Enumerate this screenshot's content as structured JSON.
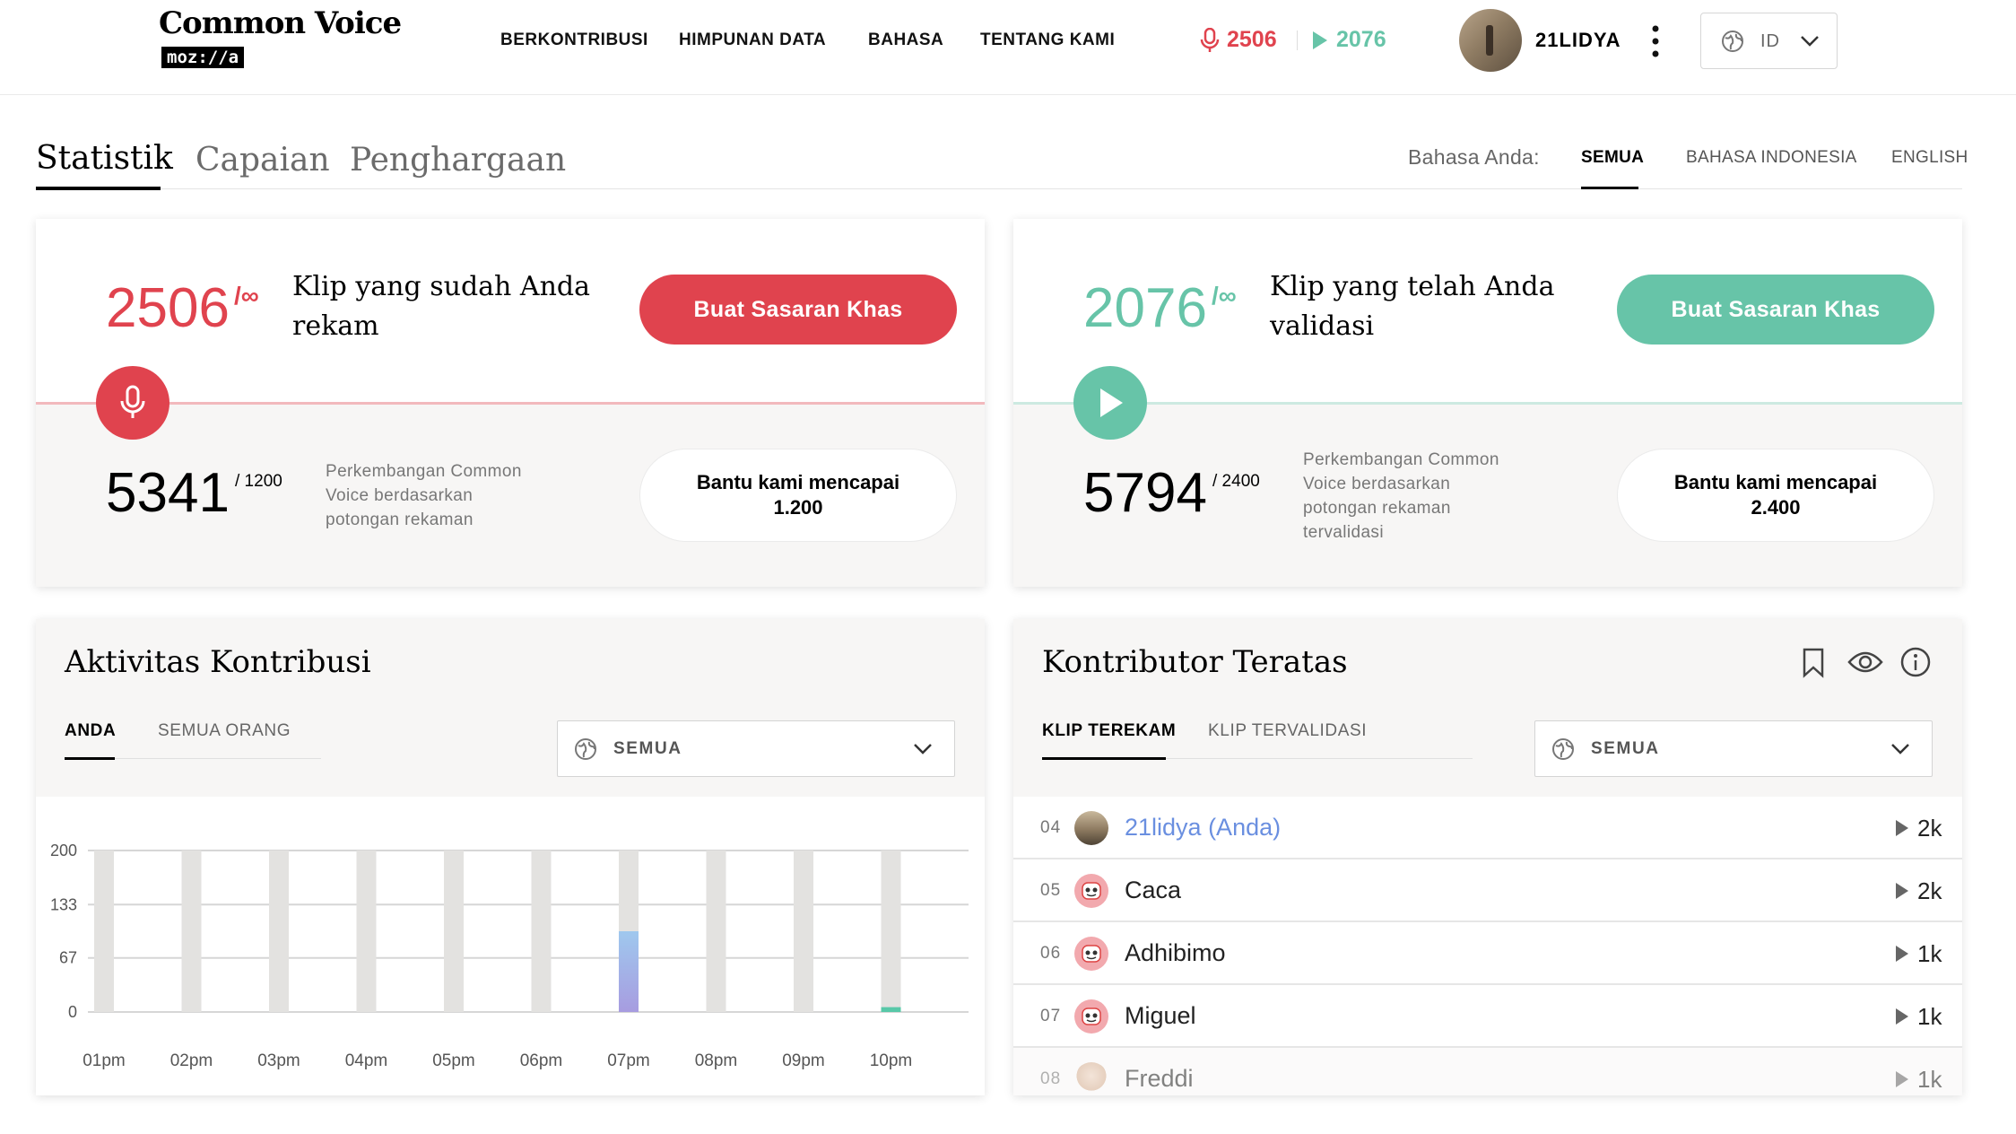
{
  "header": {
    "logo_title": "Common Voice",
    "logo_sub": "moz://a",
    "nav": [
      "BERKONTRIBUSI",
      "HIMPUNAN DATA",
      "BAHASA",
      "TENTANG KAMI"
    ],
    "recorded_count": "2506",
    "validated_count": "2076",
    "username": "21LIDYA",
    "language": "ID"
  },
  "tabs": {
    "items": [
      "Statistik",
      "Capaian",
      "Penghargaan"
    ],
    "active": "Statistik",
    "language_label": "Bahasa Anda:",
    "languages": [
      "SEMUA",
      "BAHASA INDONESIA",
      "ENGLISH"
    ],
    "active_language": "SEMUA"
  },
  "record_card": {
    "count": "2506",
    "goal_symbol": "/∞",
    "label_line1": "Klip yang sudah Anda",
    "label_line2": "rekam",
    "button": "Buat Sasaran Khas",
    "progress": "5341",
    "progress_goal": "/ 1200",
    "progress_desc": [
      "Perkembangan Common",
      "Voice berdasarkan",
      "potongan rekaman"
    ],
    "help_line1": "Bantu kami mencapai",
    "help_line2": "1.200"
  },
  "validate_card": {
    "count": "2076",
    "goal_symbol": "/∞",
    "label_line1": "Klip yang telah Anda",
    "label_line2": "validasi",
    "button": "Buat Sasaran Khas",
    "progress": "5794",
    "progress_goal": "/ 2400",
    "progress_desc": [
      "Perkembangan Common",
      "Voice berdasarkan",
      "potongan rekaman",
      "tervalidasi"
    ],
    "help_line1": "Bantu kami mencapai",
    "help_line2": "2.400"
  },
  "activity": {
    "title": "Aktivitas Kontribusi",
    "tabs": [
      "ANDA",
      "SEMUA ORANG"
    ],
    "active_tab": "ANDA",
    "dropdown": "SEMUA"
  },
  "chart_data": {
    "type": "bar",
    "categories": [
      "01pm",
      "02pm",
      "03pm",
      "04pm",
      "05pm",
      "06pm",
      "07pm",
      "08pm",
      "09pm",
      "10pm"
    ],
    "series": [
      {
        "values": [
          0,
          0,
          0,
          0,
          0,
          0,
          100,
          0,
          0,
          6
        ]
      }
    ],
    "yticks": [
      "200",
      "133",
      "67",
      "0"
    ],
    "ylim": [
      0,
      200
    ],
    "background_bars": true,
    "colors": {
      "bar": "#9fb7ea",
      "bar_end": "#58c8a8",
      "track": "#e3e2e0"
    }
  },
  "leaderboard": {
    "title": "Kontributor Teratas",
    "tabs": [
      "KLIP TEREKAM",
      "KLIP TERVALIDASI"
    ],
    "active_tab": "KLIP TEREKAM",
    "dropdown": "SEMUA",
    "rows": [
      {
        "rank": "04",
        "name": "21lidya (Anda)",
        "count": "2k",
        "self": true,
        "avatar": "photo"
      },
      {
        "rank": "05",
        "name": "Caca",
        "count": "2k",
        "avatar": "robot"
      },
      {
        "rank": "06",
        "name": "Adhibimo",
        "count": "1k",
        "avatar": "robot"
      },
      {
        "rank": "07",
        "name": "Miguel",
        "count": "1k",
        "avatar": "robot"
      },
      {
        "rank": "08",
        "name": "Freddi",
        "count": "1k",
        "avatar": "face"
      }
    ]
  },
  "colors": {
    "record": "#e0434e",
    "validate": "#67c4a8",
    "self_link": "#6a8fe0"
  }
}
